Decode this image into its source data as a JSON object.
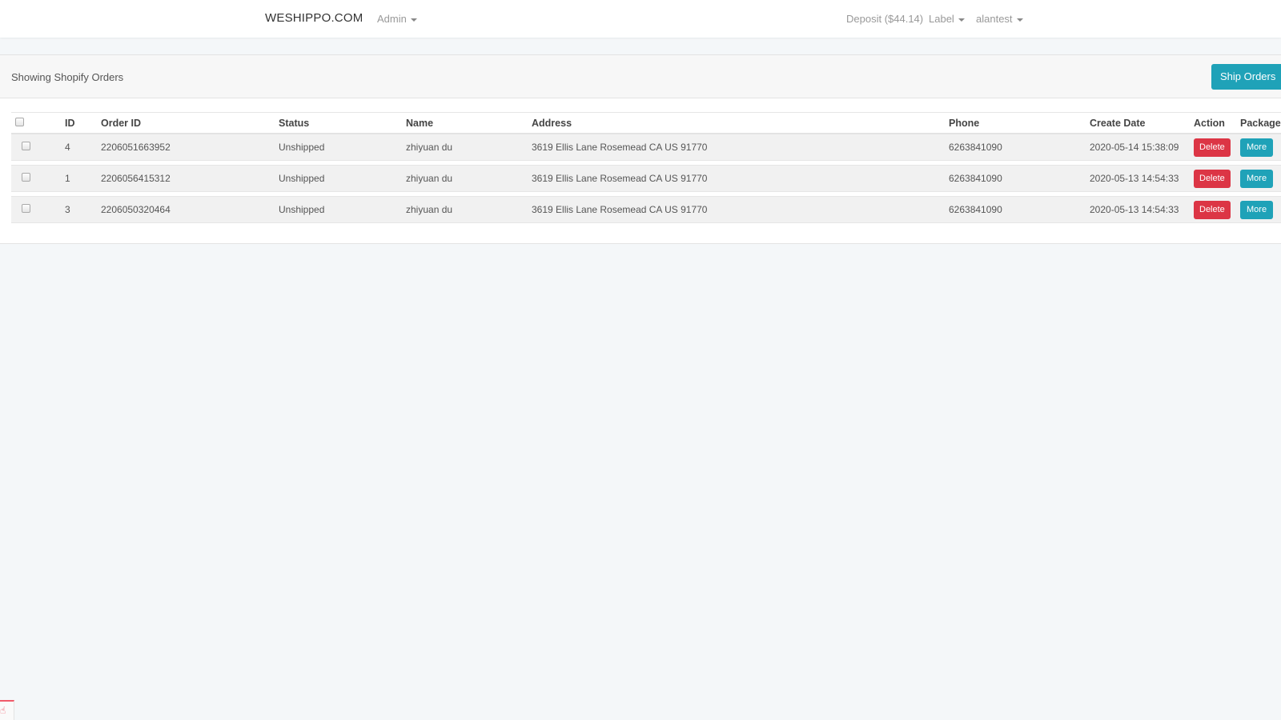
{
  "navbar": {
    "brand": "WESHIPPO.COM",
    "admin_menu": "Admin",
    "deposit": "Deposit ($44.14)",
    "label_menu": "Label",
    "user_menu": "alantest"
  },
  "panel": {
    "title": "Showing Shopify Orders",
    "ship_button": "Ship Orders"
  },
  "table": {
    "columns": [
      "ID",
      "Order ID",
      "Status",
      "Name",
      "Address",
      "Phone",
      "Create Date",
      "Action",
      "Package"
    ],
    "rows": [
      {
        "id": "4",
        "order_id": "2206051663952",
        "status": "Unshipped",
        "name": "zhiyuan du",
        "address": "3619 Ellis Lane Rosemead CA US 91770",
        "phone": "6263841090",
        "create_date": "2020-05-14 15:38:09",
        "action": "Delete",
        "package": "More"
      },
      {
        "id": "1",
        "order_id": "2206056415312",
        "status": "Unshipped",
        "name": "zhiyuan du",
        "address": "3619 Ellis Lane Rosemead CA US 91770",
        "phone": "6263841090",
        "create_date": "2020-05-13 14:54:33",
        "action": "Delete",
        "package": "More"
      },
      {
        "id": "3",
        "order_id": "2206050320464",
        "status": "Unshipped",
        "name": "zhiyuan du",
        "address": "3619 Ellis Lane Rosemead CA US 91770",
        "phone": "6263841090",
        "create_date": "2020-05-13 14:54:33",
        "action": "Delete",
        "package": "More"
      }
    ]
  },
  "widget": {
    "icon": "hand-icon",
    "glyph": "☝"
  },
  "colors": {
    "primary": "#1fa2b8",
    "danger": "#dc3545"
  }
}
